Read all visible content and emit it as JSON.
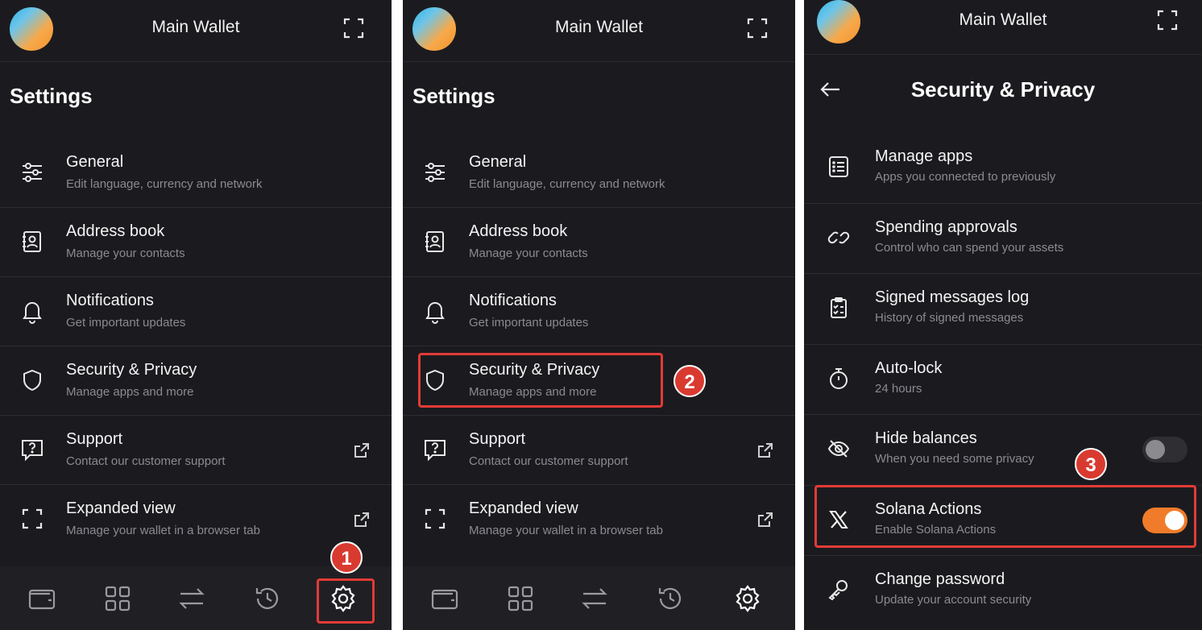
{
  "wallet_title": "Main Wallet",
  "settings": {
    "title": "Settings",
    "items": [
      {
        "title": "General",
        "subtitle": "Edit language, currency and network",
        "icon": "sliders-icon"
      },
      {
        "title": "Address book",
        "subtitle": "Manage your contacts",
        "icon": "contact-book-icon"
      },
      {
        "title": "Notifications",
        "subtitle": "Get important updates",
        "icon": "bell-icon"
      },
      {
        "title": "Security & Privacy",
        "subtitle": "Manage apps and more",
        "icon": "shield-icon"
      },
      {
        "title": "Support",
        "subtitle": "Contact our customer support",
        "icon": "help-chat-icon"
      },
      {
        "title": "Expanded view",
        "subtitle": "Manage your wallet in a browser tab",
        "icon": "expand-icon"
      }
    ]
  },
  "bottom_nav": [
    "wallet-icon",
    "apps-grid-icon",
    "swap-icon",
    "history-icon",
    "settings-gear-icon"
  ],
  "security": {
    "title": "Security & Privacy",
    "items": [
      {
        "title": "Manage apps",
        "subtitle": "Apps you connected to previously",
        "icon": "list-icon"
      },
      {
        "title": "Spending approvals",
        "subtitle": "Control who can spend your assets",
        "icon": "link-icon"
      },
      {
        "title": "Signed messages log",
        "subtitle": "History of signed messages",
        "icon": "clipboard-check-icon"
      },
      {
        "title": "Auto-lock",
        "subtitle": "24 hours",
        "icon": "stopwatch-icon"
      },
      {
        "title": "Hide balances",
        "subtitle": "When you need some privacy",
        "icon": "eye-off-icon",
        "toggle": false
      },
      {
        "title": "Solana Actions",
        "subtitle": "Enable Solana Actions",
        "icon": "x-logo-icon",
        "toggle": true
      },
      {
        "title": "Change password",
        "subtitle": "Update your account security",
        "icon": "key-icon"
      }
    ]
  },
  "step_badges": [
    "1",
    "2",
    "3"
  ],
  "colors": {
    "panel_bg": "#1b1b1f",
    "accent_orange": "#f07b2a",
    "highlight_red": "#e23b36"
  }
}
